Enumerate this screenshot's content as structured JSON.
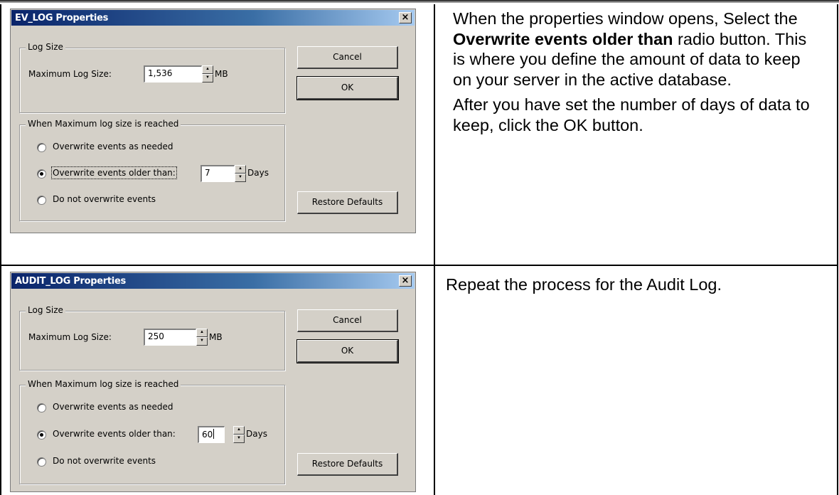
{
  "dialog1": {
    "title": "EV_LOG Properties",
    "close_glyph": "×",
    "log_size_legend": "Log Size",
    "max_log_size_label": "Maximum Log Size:",
    "max_log_size_value": "1,536",
    "size_unit": "MB",
    "cancel_label": "Cancel",
    "ok_label": "OK",
    "when_max_legend": "When Maximum log size is reached",
    "option_overwrite_needed": "Overwrite events as needed",
    "option_overwrite_older": "Overwrite events older than:",
    "days_value": "7",
    "days_unit": "Days",
    "option_do_not_overwrite": "Do not overwrite events",
    "restore_defaults_label": "Restore Defaults",
    "selected_option": "overwrite_older"
  },
  "instructions1": {
    "line_a": "When the properties window opens, Select the ",
    "bold": "Overwrite events older than",
    "line_b": " radio button. This is where you define the amount of data to keep on your server in the active database.",
    "paragraph2": "After you have set the number of days of data to keep, click the OK button."
  },
  "dialog2": {
    "title": "AUDIT_LOG Properties",
    "close_glyph": "×",
    "log_size_legend": "Log Size",
    "max_log_size_label": "Maximum Log Size:",
    "max_log_size_value": "250",
    "size_unit": "MB",
    "cancel_label": "Cancel",
    "ok_label": "OK",
    "when_max_legend": "When Maximum log size is reached",
    "option_overwrite_needed": "Overwrite events as needed",
    "option_overwrite_older": "Overwrite events older than:",
    "days_value": "60",
    "days_unit": "Days",
    "option_do_not_overwrite": "Do not overwrite events",
    "restore_defaults_label": "Restore Defaults",
    "selected_option": "overwrite_older"
  },
  "instructions2": {
    "text": "Repeat the process for the Audit Log."
  },
  "colors": {
    "dialog_face": "#d4d0c8",
    "titlebar_start": "#0a246a",
    "titlebar_end": "#a6caf0",
    "table_border": "#000000"
  }
}
